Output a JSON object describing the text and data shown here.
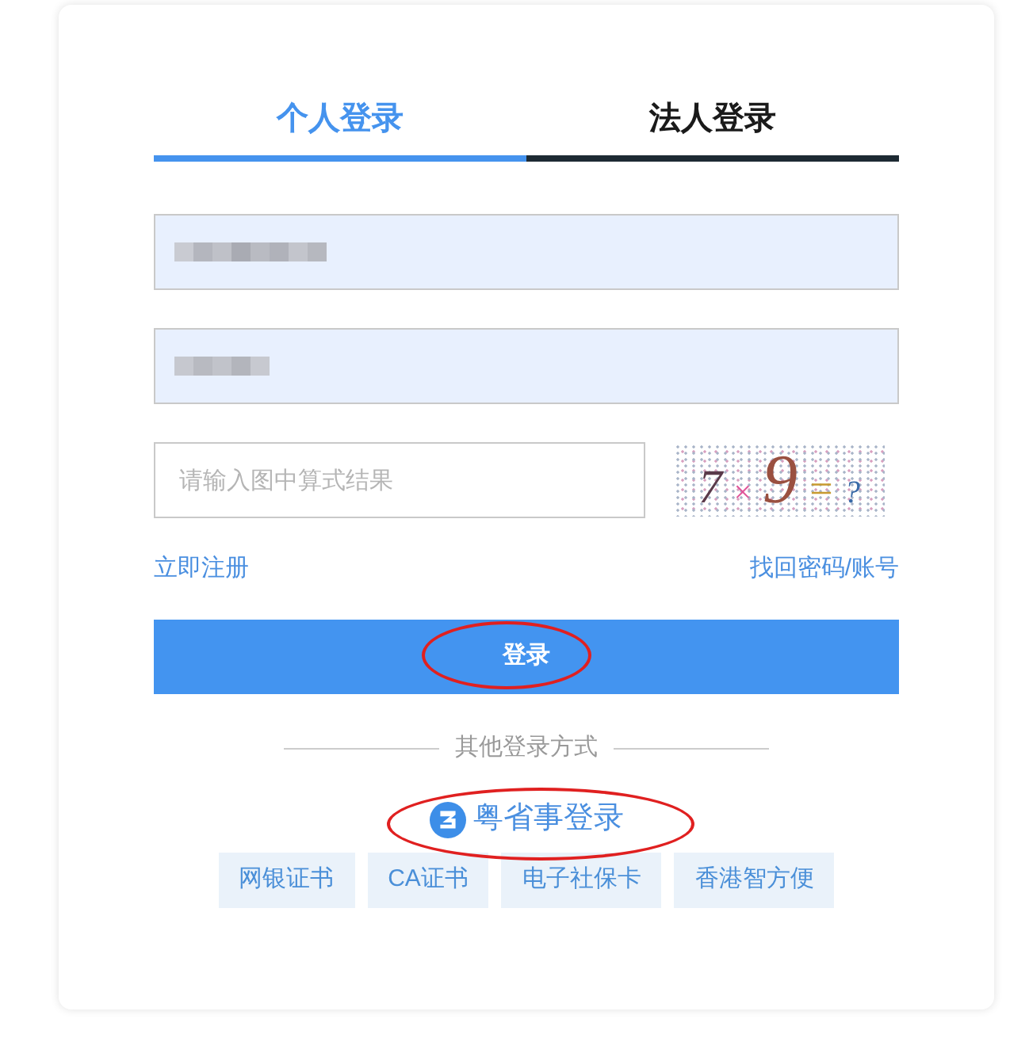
{
  "tabs": [
    {
      "label": "个人登录",
      "selected": true
    },
    {
      "label": "法人登录",
      "selected": false
    }
  ],
  "fields": [
    {
      "blurred": true
    },
    {
      "blurred": true
    }
  ],
  "captcha": {
    "placeholder": "请输入图中算式结果",
    "expression": "7×9=?"
  },
  "links": {
    "register": "立即注册",
    "recover": "找回密码/账号"
  },
  "login_button": {
    "label": "登录",
    "circled": true
  },
  "other_login": {
    "heading": "其他登录方式",
    "primary": {
      "label": "粤省事登录",
      "circled": true
    },
    "methods": [
      "网银证书",
      "CA证书",
      "电子社保卡",
      "香港智方便"
    ]
  }
}
